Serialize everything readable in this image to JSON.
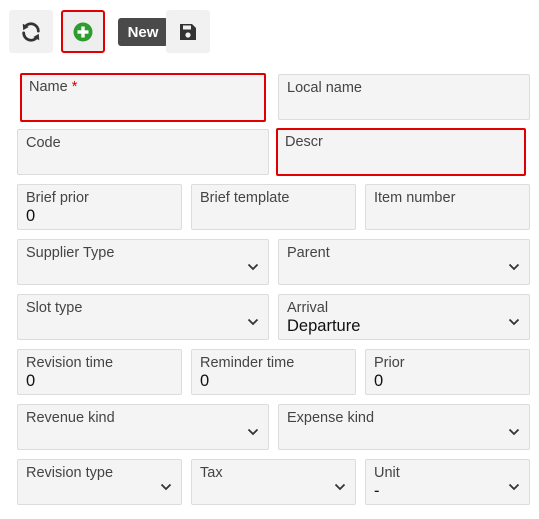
{
  "toolbar": {
    "refresh_icon": "refresh-icon",
    "add_icon": "plus-circle-icon",
    "save_icon": "floppy-disk-icon",
    "tooltip_label": "New",
    "add_color": "#2e9d2e"
  },
  "form": {
    "name": {
      "label": "Name",
      "required_mark": "*",
      "value": ""
    },
    "local_name": {
      "label": "Local name",
      "value": ""
    },
    "code": {
      "label": "Code",
      "value": ""
    },
    "descr": {
      "label": "Descr",
      "value": ""
    },
    "brief_prior": {
      "label": "Brief prior",
      "value": "0"
    },
    "brief_template": {
      "label": "Brief template",
      "value": ""
    },
    "item_number": {
      "label": "Item number",
      "value": ""
    },
    "supplier_type": {
      "label": "Supplier Type",
      "value": ""
    },
    "parent": {
      "label": "Parent",
      "value": ""
    },
    "slot_type": {
      "label": "Slot type",
      "value": ""
    },
    "arrival": {
      "label": "Arrival",
      "value": "Departure"
    },
    "revision_time": {
      "label": "Revision time",
      "value": "0"
    },
    "reminder_time": {
      "label": "Reminder time",
      "value": "0"
    },
    "prior": {
      "label": "Prior",
      "value": "0"
    },
    "revenue_kind": {
      "label": "Revenue kind",
      "value": ""
    },
    "expense_kind": {
      "label": "Expense kind",
      "value": ""
    },
    "revision_type": {
      "label": "Revision type",
      "value": ""
    },
    "tax": {
      "label": "Tax",
      "value": ""
    },
    "unit": {
      "label": "Unit",
      "value": "-"
    }
  },
  "colors": {
    "highlight": "#e00000",
    "required": "#d00000"
  }
}
